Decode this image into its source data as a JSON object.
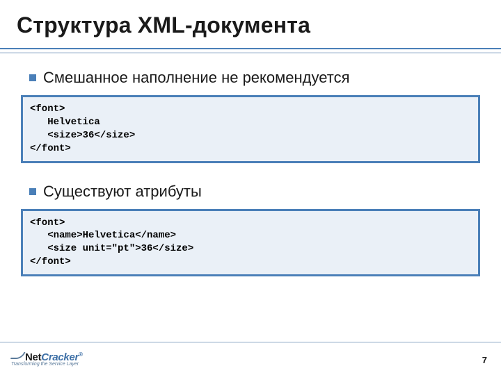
{
  "title": "Структура XML-документа",
  "bullets": {
    "mixed": "Смешанное наполнение не рекомендуется",
    "attrs": "Существуют атрибуты"
  },
  "code": {
    "mixed": "<font>\n   Helvetica\n   <size>36</size>\n</font>",
    "attrs": "<font>\n   <name>Helvetica</name>\n   <size unit=\"pt\">36</size>\n</font>"
  },
  "footer": {
    "logo_main_a": "Net",
    "logo_main_b": "Cracker",
    "logo_reg": "®",
    "logo_tag": "Transforming the Service Layer",
    "page": "7"
  }
}
